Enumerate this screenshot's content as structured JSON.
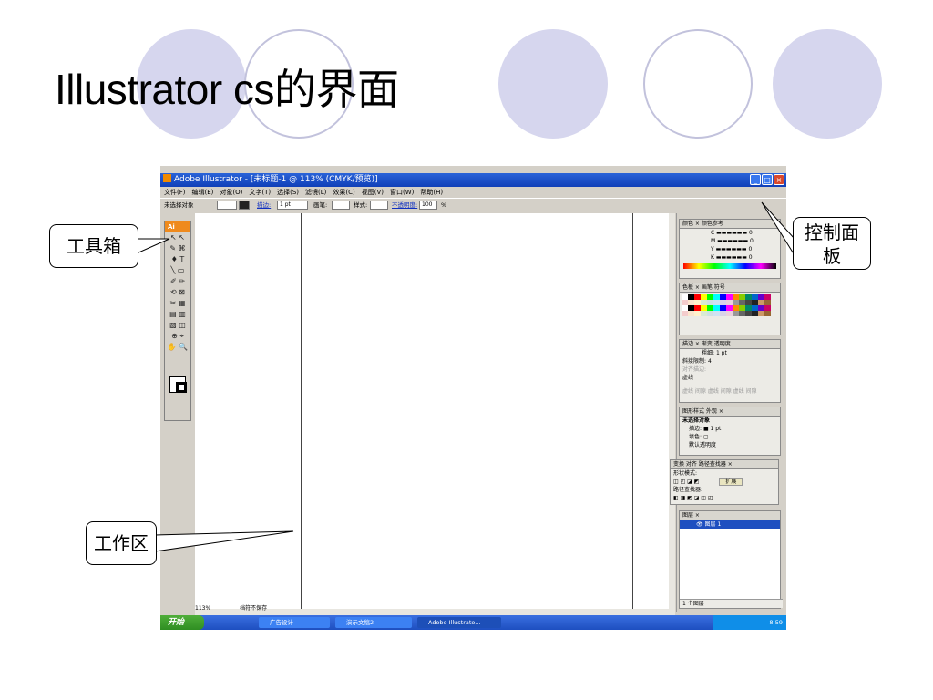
{
  "slide": {
    "title": "Illustrator cs的界面",
    "callouts": {
      "toolbox": "工具箱",
      "control_panel": "控制面板",
      "workspace": "工作区"
    }
  },
  "app": {
    "window_title": "Adobe Illustrator - [未标题-1 @ 113% (CMYK/预览)]",
    "window_buttons": [
      "_",
      "□",
      "×"
    ],
    "menu": [
      "文件(F)",
      "编辑(E)",
      "对象(O)",
      "文字(T)",
      "选择(S)",
      "滤镜(L)",
      "效果(C)",
      "视图(V)",
      "窗口(W)",
      "帮助(H)"
    ],
    "control_bar": {
      "selection": "未选择对象",
      "stroke_label": "描边:",
      "stroke_value": "1 pt",
      "brush_label": "画笔:",
      "style_label": "样式:",
      "opacity_label": "不透明度:",
      "opacity_value": "100",
      "opacity_unit": "%"
    },
    "toolbox": {
      "header": "Ai",
      "tools": [
        "↖ ↖",
        "✎ ⌘",
        "♦ T",
        "╲ ▭",
        "✐ ✏",
        "⟲ ⊠",
        "✂ ▦",
        "▤ ▥",
        "▧ ◫",
        "⊕ ⌖",
        "✋ 🔍"
      ]
    },
    "status": {
      "zoom": "113%",
      "save_state": "档符不保存"
    },
    "panels": {
      "color_tabs": "颜色 × 颜色参考",
      "color_channels": [
        {
          "label": "C",
          "value": "0"
        },
        {
          "label": "M",
          "value": "0"
        },
        {
          "label": "Y",
          "value": "0"
        },
        {
          "label": "K",
          "value": "0"
        }
      ],
      "swatch_tabs": "色板 × 画笔 符号",
      "stroke_tabs": "描边 × 渐变 透明度",
      "stroke_weight_label": "粗细:",
      "stroke_weight_value": "1 pt",
      "miter_label": "斜接限制:",
      "miter_value": "4",
      "align_label": "对齐描边:",
      "dashed_label": "虚线",
      "dash_labels": "虚线 间隙 虚线 间隙 虚线 间隙",
      "appearance_tabs": "图形样式 外观 ×",
      "appearance_title": "未选择对象",
      "appearance_stroke": "描边:",
      "appearance_stroke_value": "1 pt",
      "appearance_fill": "填色:",
      "appearance_opacity": "默认透明度",
      "pathfinder_tabs": "变换 对齐 路径查找器 ×",
      "shape_modes": "形状模式:",
      "expand_button": "扩展",
      "pathfinders": "路径查找器:",
      "layers_tab": "图层 ×",
      "layer_name": "图层 1",
      "layers_footer": "1 个图层"
    },
    "taskbar": {
      "start": "开始",
      "items": [
        "广告设计",
        "演示文稿2",
        "Adobe Illustrato..."
      ],
      "clock": "8:59"
    }
  }
}
